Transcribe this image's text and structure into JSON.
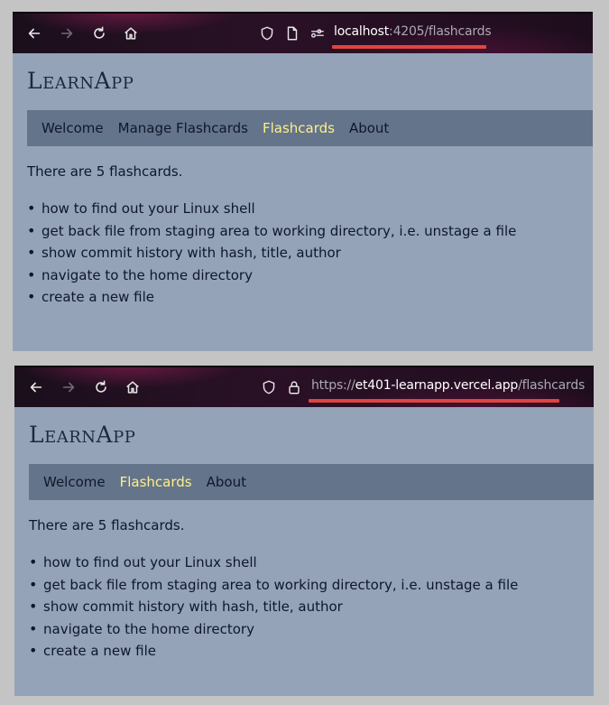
{
  "screenshots": [
    {
      "toolbar": {
        "back_icon": "arrow-left-icon",
        "forward_icon": "arrow-right-icon",
        "reload_icon": "reload-icon",
        "home_icon": "home-icon",
        "url_host": "localhost",
        "url_rest": ":4205/flashcards"
      },
      "app_title": "LearnApp",
      "nav": [
        "Welcome",
        "Manage Flashcards",
        "Flashcards",
        "About"
      ],
      "active_nav": "Flashcards",
      "count_text": "There are 5 flashcards.",
      "cards": [
        "how to find out your Linux shell",
        "get back file from staging area to working directory, i.e. unstage a file",
        "show commit history with hash, title, author",
        "navigate to the home directory",
        "create a new file"
      ]
    },
    {
      "toolbar": {
        "back_icon": "arrow-left-icon",
        "forward_icon": "arrow-right-icon",
        "reload_icon": "reload-icon",
        "home_icon": "home-icon",
        "url_scheme": "https://",
        "url_host": "et401-learnapp.vercel.app",
        "url_rest": "/flashcards"
      },
      "app_title": "LearnApp",
      "nav": [
        "Welcome",
        "Flashcards",
        "About"
      ],
      "active_nav": "Flashcards",
      "count_text": "There are 5 flashcards.",
      "cards": [
        "how to find out your Linux shell",
        "get back file from staging area to working directory, i.e. unstage a file",
        "show commit history with hash, title, author",
        "navigate to the home directory",
        "create a new file"
      ]
    }
  ],
  "colors": {
    "page_bg": "#94a3b8",
    "nav_bg": "#64748b",
    "nav_active": "#fef08a",
    "url_underline": "#e0453f"
  }
}
